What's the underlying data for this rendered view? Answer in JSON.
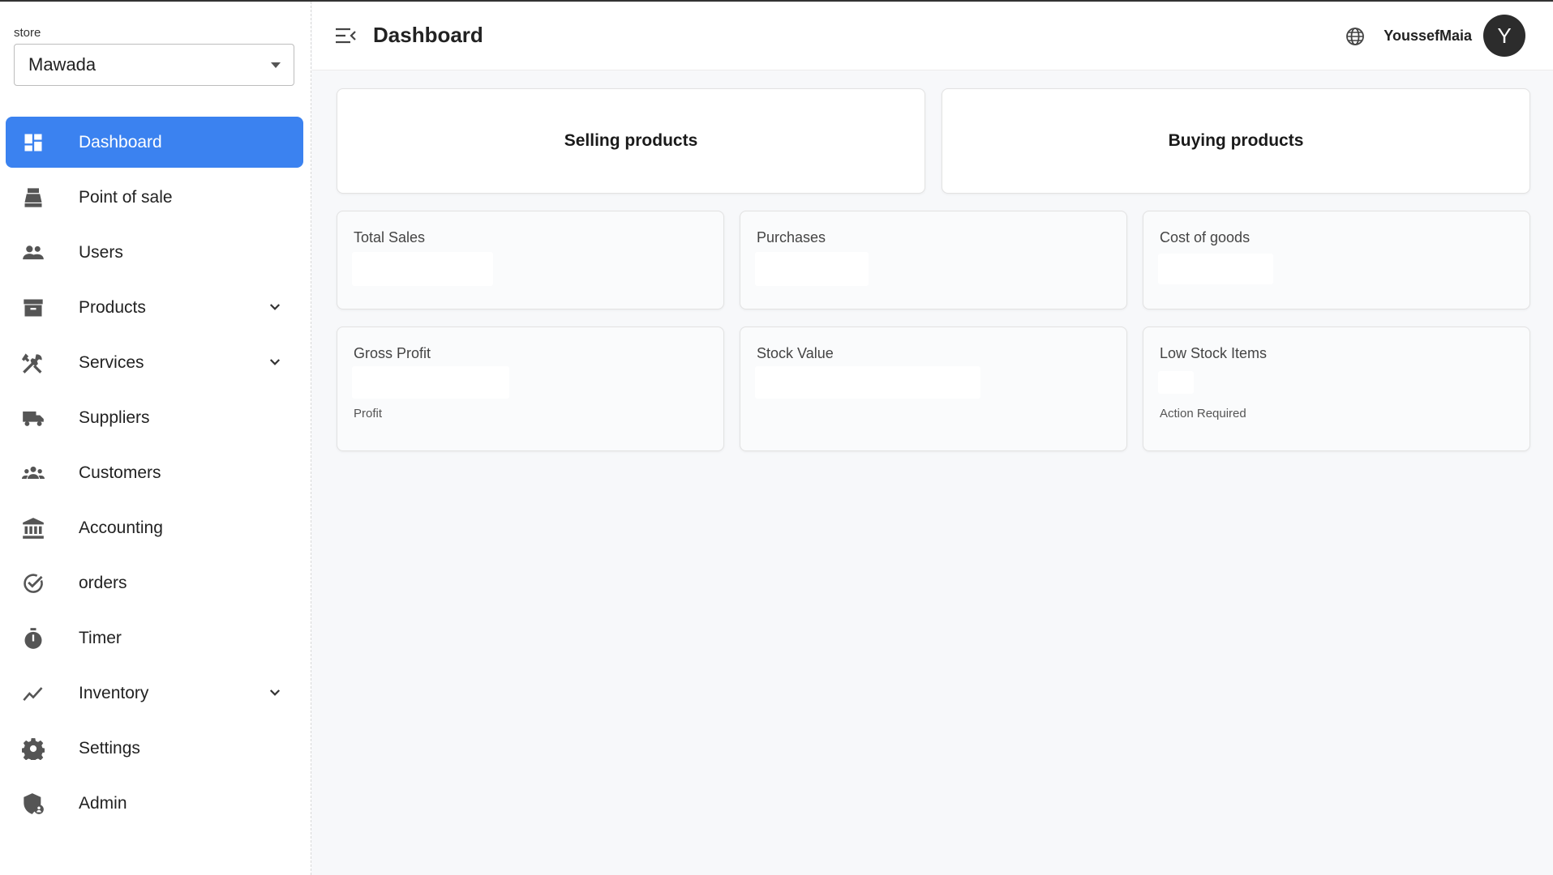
{
  "sidebar": {
    "store_label": "store",
    "store_value": "Mawada",
    "items": [
      {
        "label": "Dashboard",
        "icon": "dashboard-icon",
        "active": true
      },
      {
        "label": "Point of sale",
        "icon": "cash-register-icon"
      },
      {
        "label": "Users",
        "icon": "users-icon"
      },
      {
        "label": "Products",
        "icon": "archive-box-icon",
        "expandable": true
      },
      {
        "label": "Services",
        "icon": "tools-icon",
        "expandable": true
      },
      {
        "label": "Suppliers",
        "icon": "truck-icon"
      },
      {
        "label": "Customers",
        "icon": "group-icon"
      },
      {
        "label": "Accounting",
        "icon": "bank-icon"
      },
      {
        "label": "orders",
        "icon": "check-circle-icon"
      },
      {
        "label": "Timer",
        "icon": "timer-icon"
      },
      {
        "label": "Inventory",
        "icon": "trending-icon",
        "expandable": true
      },
      {
        "label": "Settings",
        "icon": "gear-icon"
      },
      {
        "label": "Admin",
        "icon": "admin-shield-icon"
      }
    ]
  },
  "header": {
    "title": "Dashboard",
    "username": "YoussefMaia",
    "avatar_initial": "Y"
  },
  "main": {
    "big_cards": [
      {
        "label": "Selling products"
      },
      {
        "label": "Buying products"
      }
    ],
    "stats": [
      {
        "title": "Total Sales",
        "sub": ""
      },
      {
        "title": "Purchases",
        "sub": ""
      },
      {
        "title": "Cost of goods",
        "sub": ""
      },
      {
        "title": "Gross Profit",
        "sub": "Profit"
      },
      {
        "title": "Stock Value",
        "sub": ""
      },
      {
        "title": "Low Stock Items",
        "sub": "Action Required"
      }
    ]
  },
  "colors": {
    "accent": "#3b82f0",
    "icon": "#555555"
  }
}
